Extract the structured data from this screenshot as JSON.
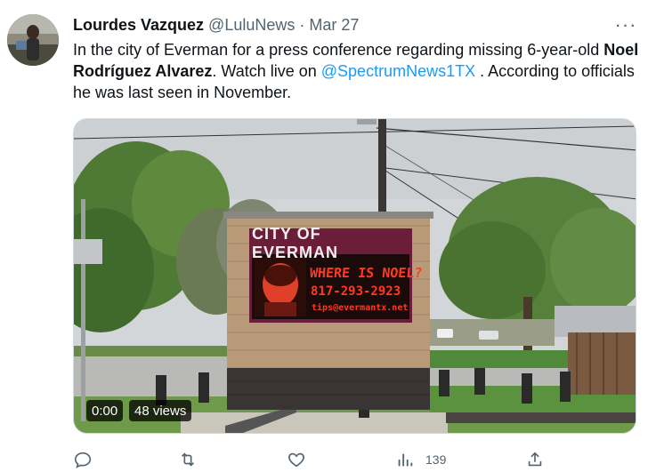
{
  "tweet": {
    "author_name": "Lourdes Vazquez",
    "handle": "@LuluNews",
    "separator": "·",
    "date": "Mar 27",
    "more_label": "···",
    "text_part1": "In the city of Everman for a press conference regarding missing 6-year-old ",
    "text_bold": "Noel Rodríguez Alvarez",
    "text_part2": ". Watch live on ",
    "mention": "@SpectrumNews1TX",
    "text_part3": " . According to officials he was last seen in November."
  },
  "media": {
    "sign_title": "CITY OF EVERMAN",
    "led_line1": "WHERE IS NOEL?",
    "led_line2": "817-293-2923",
    "led_line3": "tips@evermantx.net",
    "video_time": "0:00",
    "video_views": "48 views"
  },
  "actions": {
    "reply_icon": "reply-icon",
    "retweet_icon": "retweet-icon",
    "like_icon": "like-icon",
    "views_icon": "views-icon",
    "views_count": "139",
    "share_icon": "share-icon"
  },
  "colors": {
    "link": "#1d9bf0",
    "secondary_text": "#536471",
    "sign_panel": "#6b1e3a",
    "led": "#ff3a22"
  }
}
